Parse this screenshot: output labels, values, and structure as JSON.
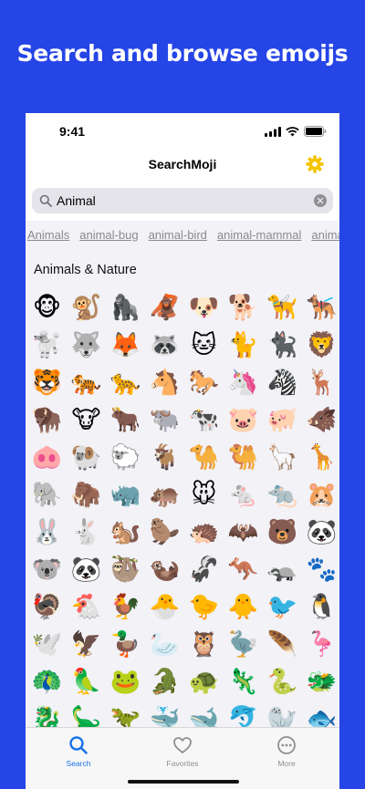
{
  "headline": "Search and browse emoijs",
  "status": {
    "time": "9:41"
  },
  "nav": {
    "title": "SearchMoji",
    "settings_icon": "gear-icon"
  },
  "search": {
    "value": "Animal",
    "icon": "search-icon",
    "clear_icon": "clear-icon"
  },
  "tags": [
    "Animals",
    "animal-bug",
    "animal-bird",
    "animal-mammal",
    "animal-amphibian"
  ],
  "section": {
    "title": "Animals & Nature"
  },
  "emojis": [
    "🐵",
    "🐒",
    "🦍",
    "🦧",
    "🐶",
    "🐕",
    "🦮",
    "🐕‍🦺",
    "🐩",
    "🐺",
    "🦊",
    "🦝",
    "🐱",
    "🐈",
    "🐈‍⬛",
    "🦁",
    "🐯",
    "🐅",
    "🐆",
    "🐴",
    "🐎",
    "🦄",
    "🦓",
    "🦌",
    "🦬",
    "🐮",
    "🐂",
    "🐃",
    "🐄",
    "🐷",
    "🐖",
    "🐗",
    "🐽",
    "🐏",
    "🐑",
    "🐐",
    "🐪",
    "🐫",
    "🦙",
    "🦒",
    "🐘",
    "🦣",
    "🦏",
    "🦛",
    "🐭",
    "🐁",
    "🐀",
    "🐹",
    "🐰",
    "🐇",
    "🐿️",
    "🦫",
    "🦔",
    "🦇",
    "🐻",
    "🐼",
    "🐨",
    "🐼",
    "🦥",
    "🦦",
    "🦨",
    "🦘",
    "🦡",
    "🐾",
    "🦃",
    "🐔",
    "🐓",
    "🐣",
    "🐤",
    "🐥",
    "🐦",
    "🐧",
    "🕊️",
    "🦅",
    "🦆",
    "🦢",
    "🦉",
    "🦤",
    "🪶",
    "🦩",
    "🦚",
    "🦜",
    "🐸",
    "🐊",
    "🐢",
    "🦎",
    "🐍",
    "🐲",
    "🐉",
    "🦕",
    "🦖",
    "🐳",
    "🐋",
    "🐬",
    "🦭",
    "🐟"
  ],
  "tabbar": {
    "tabs": [
      {
        "label": "Search",
        "icon": "search-icon",
        "active": true
      },
      {
        "label": "Favorites",
        "icon": "heart-icon",
        "active": false
      },
      {
        "label": "More",
        "icon": "more-icon",
        "active": false
      }
    ]
  },
  "colors": {
    "background": "#2545e6",
    "accent": "#1a73e8",
    "gear": "#f5c400",
    "tab_inactive": "#8e8e93"
  }
}
